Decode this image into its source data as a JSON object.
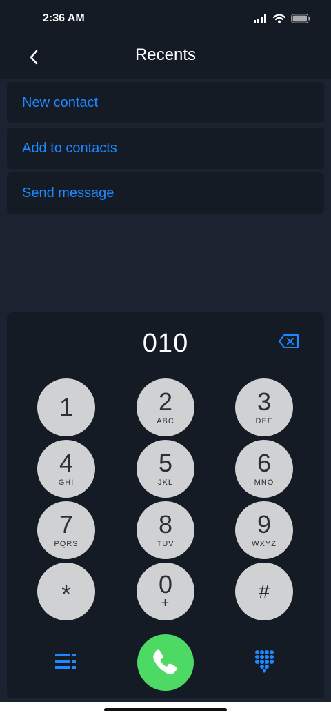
{
  "status": {
    "time": "2:36 AM"
  },
  "header": {
    "title": "Recents"
  },
  "menu": [
    "New contact",
    "Add to contacts",
    "Send message"
  ],
  "dialer": {
    "number": "010",
    "keys": [
      {
        "digit": "1",
        "letters": ""
      },
      {
        "digit": "2",
        "letters": "ABC"
      },
      {
        "digit": "3",
        "letters": "DEF"
      },
      {
        "digit": "4",
        "letters": "GHI"
      },
      {
        "digit": "5",
        "letters": "JKL"
      },
      {
        "digit": "6",
        "letters": "MNO"
      },
      {
        "digit": "7",
        "letters": "PQRS"
      },
      {
        "digit": "8",
        "letters": "TUV"
      },
      {
        "digit": "9",
        "letters": "WXYZ"
      },
      {
        "digit": "*",
        "letters": ""
      },
      {
        "digit": "0",
        "letters": "+"
      },
      {
        "digit": "#",
        "letters": ""
      }
    ]
  },
  "colors": {
    "accent": "#1e88ff",
    "call": "#4cd964",
    "key": "#d0d1d3",
    "panel": "#141b25",
    "background": "#1b2230"
  },
  "icons": {
    "back": "chevron-left-icon",
    "delete": "backspace-icon",
    "call": "phone-icon",
    "list": "list-icon",
    "keypad": "keypad-icon"
  }
}
